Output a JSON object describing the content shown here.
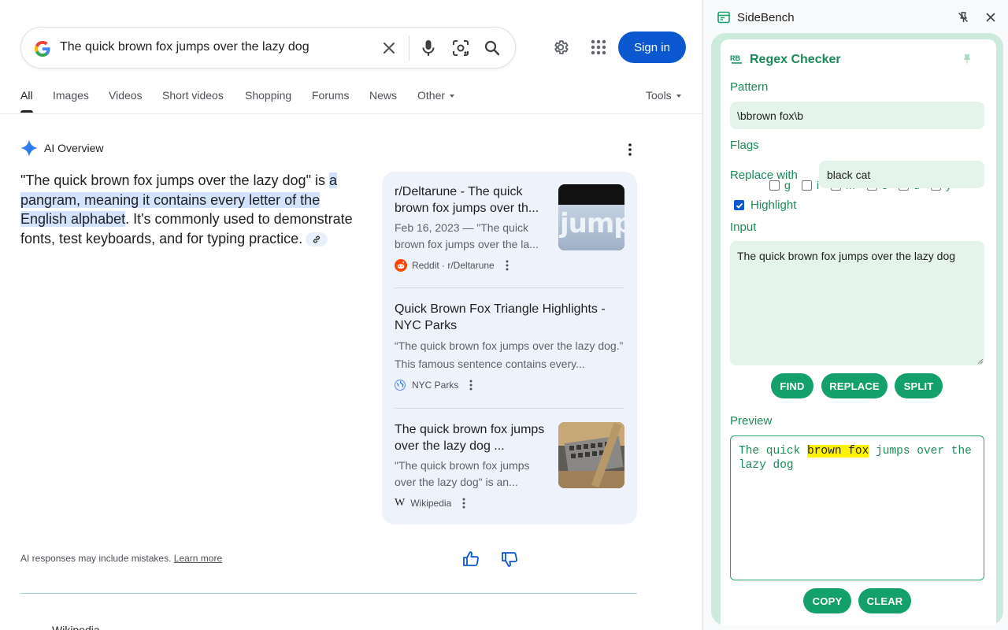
{
  "search": {
    "query": "The quick brown fox jumps over the lazy dog",
    "sign_in": "Sign in"
  },
  "tabs": [
    {
      "label": "All",
      "active": true
    },
    {
      "label": "Images"
    },
    {
      "label": "Videos"
    },
    {
      "label": "Short videos"
    },
    {
      "label": "Shopping"
    },
    {
      "label": "Forums"
    },
    {
      "label": "News"
    },
    {
      "label": "Other"
    },
    {
      "label": "Tools"
    }
  ],
  "ai_overview": {
    "title": "AI Overview",
    "text_before": "\"The quick brown fox jumps over the lazy dog\" is ",
    "text_highlight": "a pangram, meaning it contains every letter of the English alphabet",
    "text_after": ". It's commonly used to demonstrate fonts, test keyboards, and for typing practice.",
    "sources": [
      {
        "title": "r/Deltarune - The quick brown fox jumps over th...",
        "snippet": "Feb 16, 2023 — \"The quick brown fox jumps over the la...",
        "site": "Reddit · r/Deltarune",
        "thumb_text": "jump"
      },
      {
        "title": "Quick Brown Fox Triangle Highlights - NYC Parks",
        "snippet": "“The quick brown fox jumps over the lazy dog.” This famous sentence contains every...",
        "site": "NYC Parks"
      },
      {
        "title": "The quick brown fox jumps over the lazy dog ...",
        "snippet": "\"The quick brown fox jumps over the lazy dog\" is an...",
        "site": "Wikipedia"
      }
    ],
    "disclaimer": "AI responses may include mistakes.",
    "learn_more": "Learn more"
  },
  "peek_text": "Wikipedia",
  "sidebench": {
    "title": "SideBench",
    "tool_title": "Regex Checker",
    "pattern_label": "Pattern",
    "pattern_value": "\\bbrown fox\\b",
    "flags_label": "Flags",
    "flags": [
      {
        "letter": "g",
        "checked": false
      },
      {
        "letter": "i",
        "checked": false
      },
      {
        "letter": "m",
        "checked": false
      },
      {
        "letter": "s",
        "checked": false
      },
      {
        "letter": "u",
        "checked": false
      },
      {
        "letter": "y",
        "checked": false
      }
    ],
    "replace_label": "Replace with",
    "replace_value": "black cat",
    "highlight_label": "Highlight",
    "highlight_checked": true,
    "input_label": "Input",
    "input_value": "The quick brown fox jumps over the lazy dog",
    "buttons": {
      "find": "FIND",
      "replace": "REPLACE",
      "split": "SPLIT",
      "copy": "COPY",
      "clear": "CLEAR"
    },
    "preview_label": "Preview",
    "preview_before": "The quick ",
    "preview_match": "brown fox",
    "preview_after": " jumps over the lazy dog"
  },
  "colors": {
    "google_blue": "#0b57d0",
    "ai_highlight": "#d3e3fd",
    "sidebench_green": "#14a06a",
    "sidebench_frame": "#cdebdc",
    "match_highlight": "#fff200"
  }
}
